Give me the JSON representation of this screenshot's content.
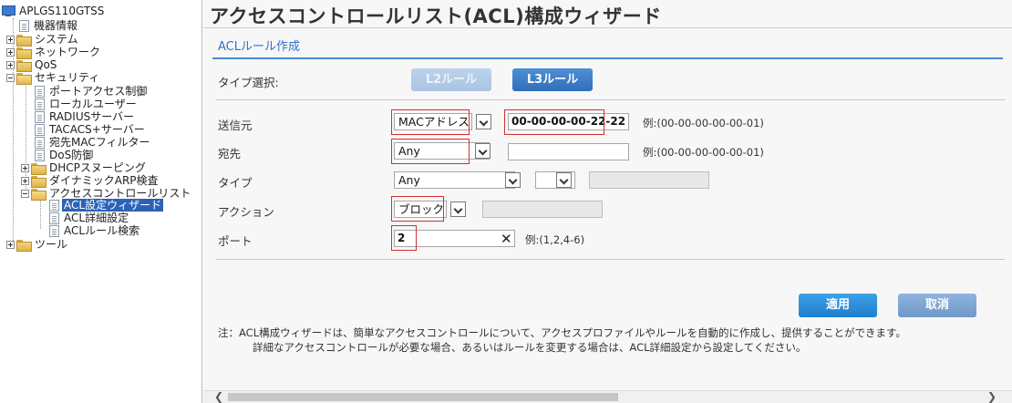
{
  "tree": {
    "root": "APLGS110GTSS",
    "items": [
      {
        "label": "機器情報"
      },
      {
        "label": "システム"
      },
      {
        "label": "ネットワーク"
      },
      {
        "label": "QoS"
      },
      {
        "label": "セキュリティ"
      },
      {
        "label": "ポートアクセス制御"
      },
      {
        "label": "ローカルユーザー"
      },
      {
        "label": "RADIUSサーバー"
      },
      {
        "label": "TACACS+サーバー"
      },
      {
        "label": "宛先MACフィルター"
      },
      {
        "label": "DoS防御"
      },
      {
        "label": "DHCPスヌーピング"
      },
      {
        "label": "ダイナミックARP検査"
      },
      {
        "label": "アクセスコントロールリスト"
      },
      {
        "label": "ACL設定ウィザード"
      },
      {
        "label": "ACL詳細設定"
      },
      {
        "label": "ACLルール検索"
      },
      {
        "label": "ツール"
      }
    ]
  },
  "page": {
    "title": "アクセスコントロールリスト(ACL)構成ウィザード",
    "section": "ACLルール作成"
  },
  "type_select": {
    "label": "タイプ選択:",
    "l2": "L2ルール",
    "l3": "L3ルール"
  },
  "form": {
    "source": {
      "label": "送信元",
      "select": "MACアドレス",
      "value": "00-00-00-00-22-22",
      "hint": "例:(00-00-00-00-00-01)"
    },
    "dest": {
      "label": "宛先",
      "select": "Any",
      "value": "",
      "hint": "例:(00-00-00-00-00-01)"
    },
    "type": {
      "label": "タイプ",
      "select": "Any",
      "select2": ""
    },
    "action": {
      "label": "アクション",
      "select": "ブロック"
    },
    "port": {
      "label": "ポート",
      "value": "2",
      "hint": "例:(1,2,4-6)"
    }
  },
  "buttons": {
    "apply": "適用",
    "cancel": "取消"
  },
  "note": {
    "line1": "注：ACL構成ウィザードは、簡単なアクセスコントロールについて、アクセスプロファイルやルールを自動的に作成し、提供することができます。",
    "line2": "詳細なアクセスコントロールが必要な場合、あるいはルールを変更する場合は、ACL詳細設定から設定してください。"
  },
  "colors": {
    "accent": "#2f72c4",
    "selected": "#2c62b6",
    "highlight": "#d23030"
  }
}
